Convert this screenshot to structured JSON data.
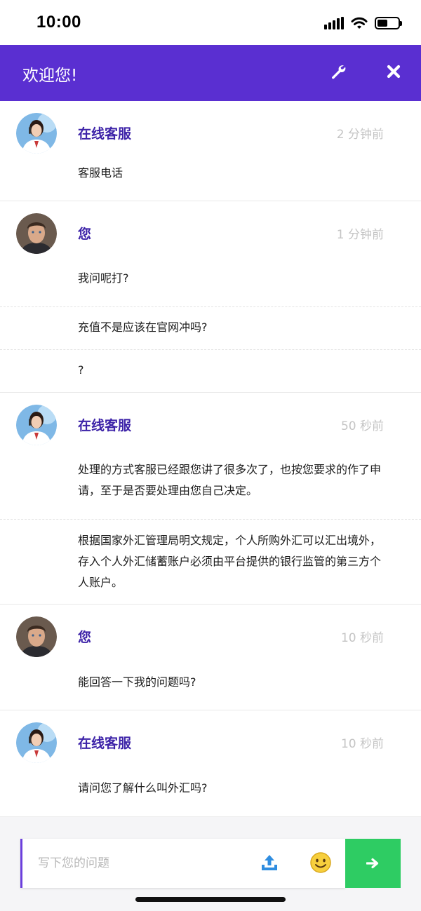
{
  "status_bar": {
    "time": "10:00"
  },
  "header": {
    "title": "欢迎您!"
  },
  "colors": {
    "header_bg": "#5a2fd1",
    "name_color": "#3d23a8",
    "send_bg": "#2ecc63"
  },
  "messages": [
    {
      "sender": "在线客服",
      "avatar": "agent-avatar",
      "time": "2 分钟前",
      "texts": [
        "客服电话"
      ]
    },
    {
      "sender": "您",
      "avatar": "user-avatar",
      "time": "1 分钟前",
      "texts": [
        "我问呢打?",
        "充值不是应该在官网冲吗?",
        "?"
      ]
    },
    {
      "sender": "在线客服",
      "avatar": "agent-avatar",
      "time": "50 秒前",
      "texts": [
        "处理的方式客服已经跟您讲了很多次了，也按您要求的作了申请，至于是否要处理由您自己决定。",
        "根据国家外汇管理局明文规定，个人所购外汇可以汇出境外，存入个人外汇储蓄账户必须由平台提供的银行监管的第三方个人账户。"
      ]
    },
    {
      "sender": "您",
      "avatar": "user-avatar",
      "time": "10 秒前",
      "texts": [
        "能回答一下我的问题吗?"
      ]
    },
    {
      "sender": "在线客服",
      "avatar": "agent-avatar",
      "time": "10 秒前",
      "texts": [
        "请问您了解什么叫外汇吗?"
      ]
    }
  ],
  "input": {
    "placeholder": "写下您的问题",
    "value": ""
  }
}
